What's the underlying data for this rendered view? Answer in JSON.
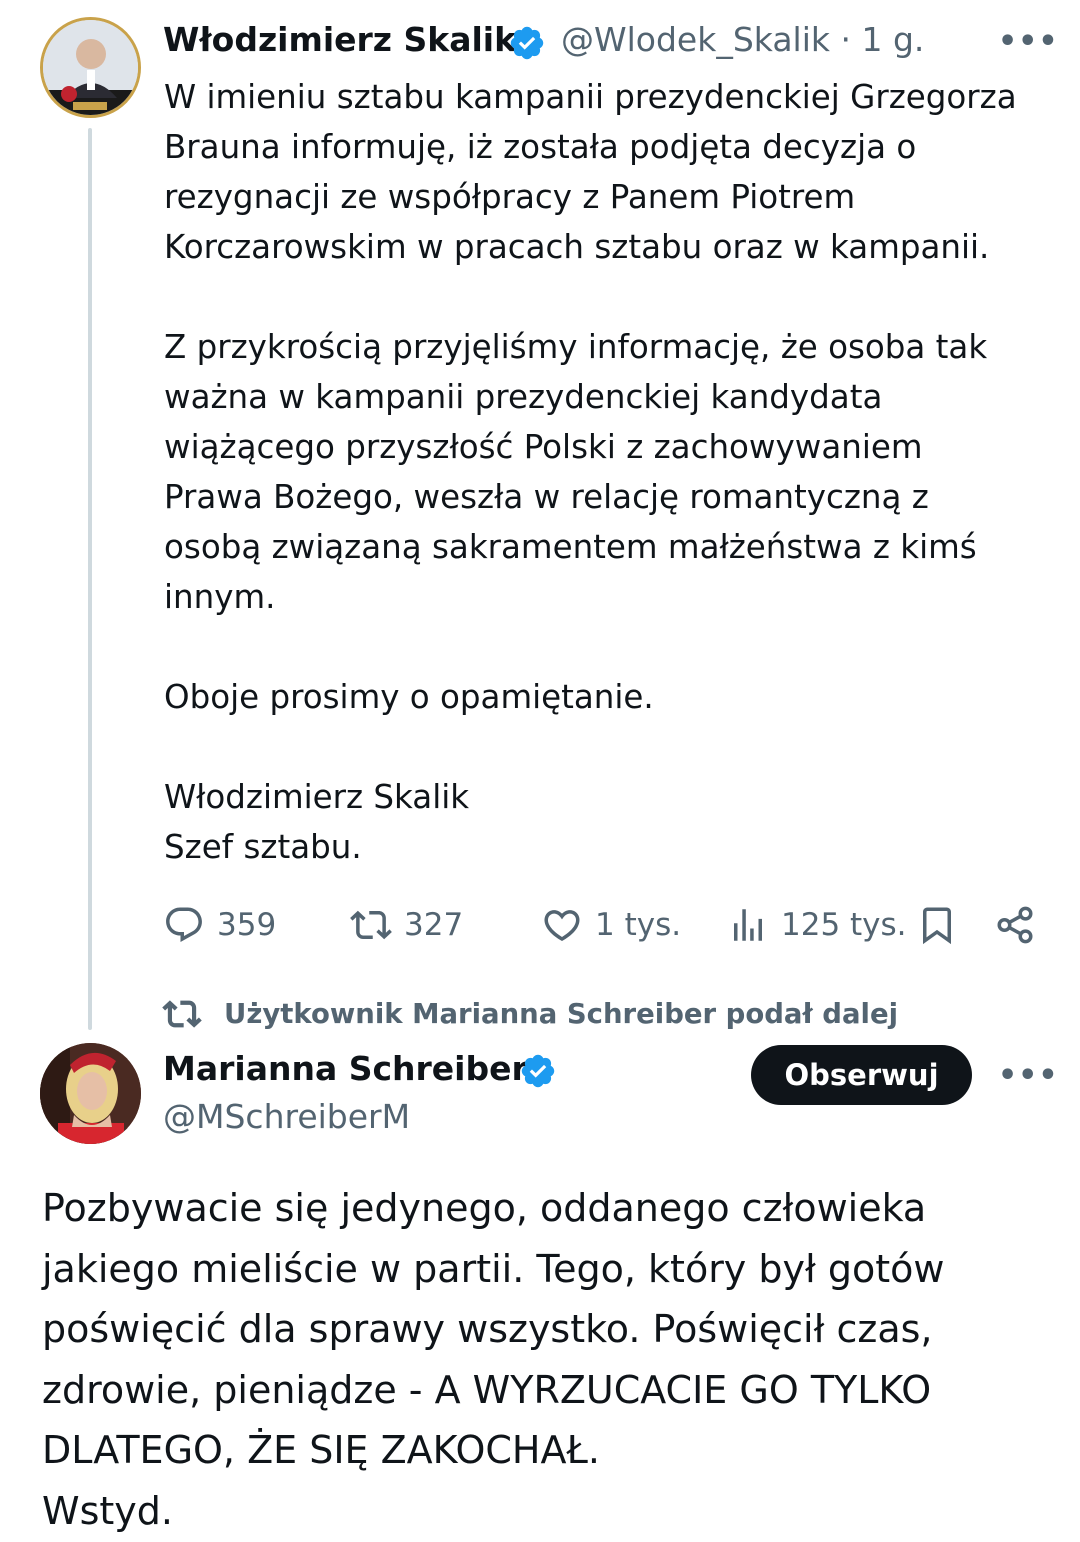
{
  "colors": {
    "verified_badge": "#1d9bf0",
    "secondary_text": "#536471",
    "primary_text": "#0f1419",
    "thread_line": "#cfd9de",
    "follow_button_bg": "#0f1419"
  },
  "tweet1": {
    "author_name": "Włodzimierz Skalik",
    "handle": "@Wlodek_Skalik",
    "separator": "·",
    "time": "1 g.",
    "more_label": "•••",
    "avatar_icon": "profile-photo",
    "verified_icon": "verified-badge-icon",
    "text": "W imieniu sztabu kampanii prezydenckiej Grzegorza\nBrauna informuję, iż została podjęta decyzja o\nrezygnacji ze współpracy z Panem Piotrem\nKorczarowskim w pracach sztabu oraz w kampanii.\n\nZ przykrością przyjęliśmy informację, że osoba tak\nważna w kampanii prezydenckiej kandydata\nwiążącego przyszłość Polski z zachowywaniem\nPrawa Bożego, weszła w relację romantyczną z\nosobą związaną sakramentem małżeństwa z kimś\ninnym.\n\nOboje prosimy o opamiętanie.\n\nWłodzimierz Skalik\nSzef sztabu.",
    "actions": {
      "replies": "359",
      "reposts": "327",
      "likes": "1 tys.",
      "views": "125 tys."
    }
  },
  "repost_note": {
    "icon": "repost-icon",
    "text": "Użytkownik Marianna Schreiber podał dalej"
  },
  "tweet2": {
    "author_name": "Marianna Schreiber",
    "handle": "@MSchreiberM",
    "follow_label": "Obserwuj",
    "more_label": "•••",
    "text": "Pozbywacie się jedynego, oddanego człowieka\njakiego mieliście w partii. Tego, który był gotów\npoświęcić dla sprawy wszystko. Poświęcił czas,\nzdrowie, pieniądze - A WYRZUCACIE GO TYLKO\nDLATEGO, ŻE SIĘ ZAKOCHAŁ.\nWstyd."
  }
}
